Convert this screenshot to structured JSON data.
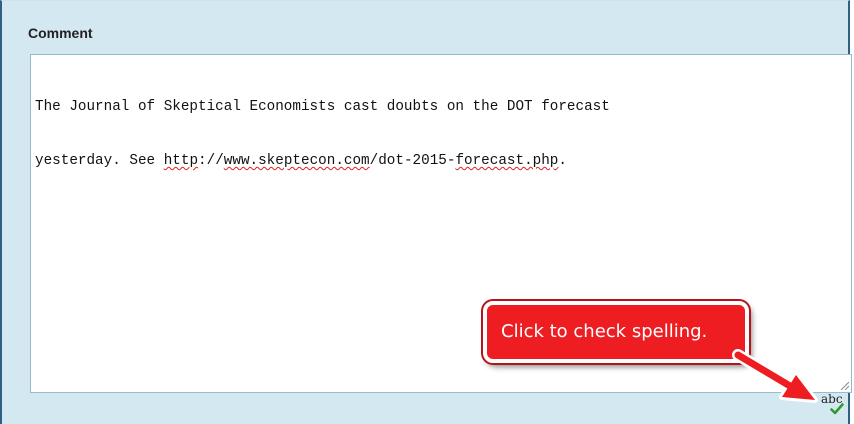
{
  "comment": {
    "label": "Comment",
    "text_line_1_a": "The Journal of Skeptical Economists cast doubts on the DOT forecast",
    "text_line_2_a": "yesterday. See ",
    "text_line_2_link1": "http",
    "text_line_2_sep1": "://",
    "text_line_2_link2": "www.skeptecon.com",
    "text_line_2_mid": "/dot-2015-",
    "text_line_2_link3": "forecast.php",
    "text_line_2_end": "."
  },
  "callout": {
    "text": "Click to check spelling."
  },
  "spellcheck": {
    "label": "abc",
    "icon": "check-icon",
    "icon_color": "#2c9a2c"
  },
  "colors": {
    "panel_background": "#d4e8f2",
    "callout_background": "#ee1d22",
    "misspelling_underline": "#e02020"
  }
}
